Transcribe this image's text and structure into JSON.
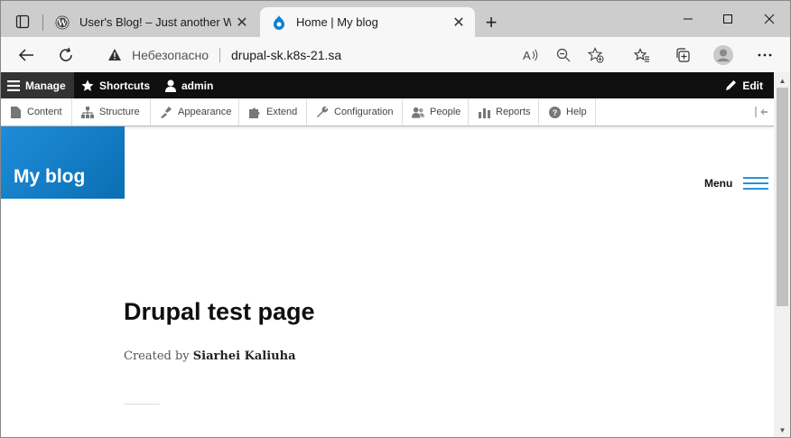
{
  "browser": {
    "tabs": [
      {
        "title": "User's Blog! – Just another Word",
        "icon": "wordpress-icon",
        "active": false
      },
      {
        "title": "Home | My blog",
        "icon": "drupal-icon",
        "active": true
      }
    ],
    "new_tab_label": "+",
    "security_label": "Небезопасно",
    "url": "drupal-sk.k8s-21.sa"
  },
  "toolbar": {
    "manage": "Manage",
    "shortcuts": "Shortcuts",
    "user": "admin",
    "edit": "Edit",
    "tray": [
      {
        "label": "Content",
        "icon": "page-icon"
      },
      {
        "label": "Structure",
        "icon": "sitemap-icon"
      },
      {
        "label": "Appearance",
        "icon": "brush-icon"
      },
      {
        "label": "Extend",
        "icon": "puzzle-icon"
      },
      {
        "label": "Configuration",
        "icon": "wrench-icon"
      },
      {
        "label": "People",
        "icon": "people-icon"
      },
      {
        "label": "Reports",
        "icon": "bar-chart-icon"
      },
      {
        "label": "Help",
        "icon": "help-icon"
      }
    ]
  },
  "site": {
    "name": "My blog",
    "menu_label": "Menu",
    "accent": "#2494db"
  },
  "article": {
    "title": "Drupal test page",
    "byline_prefix": "Created by",
    "author": "Siarhei Kaliuha"
  }
}
